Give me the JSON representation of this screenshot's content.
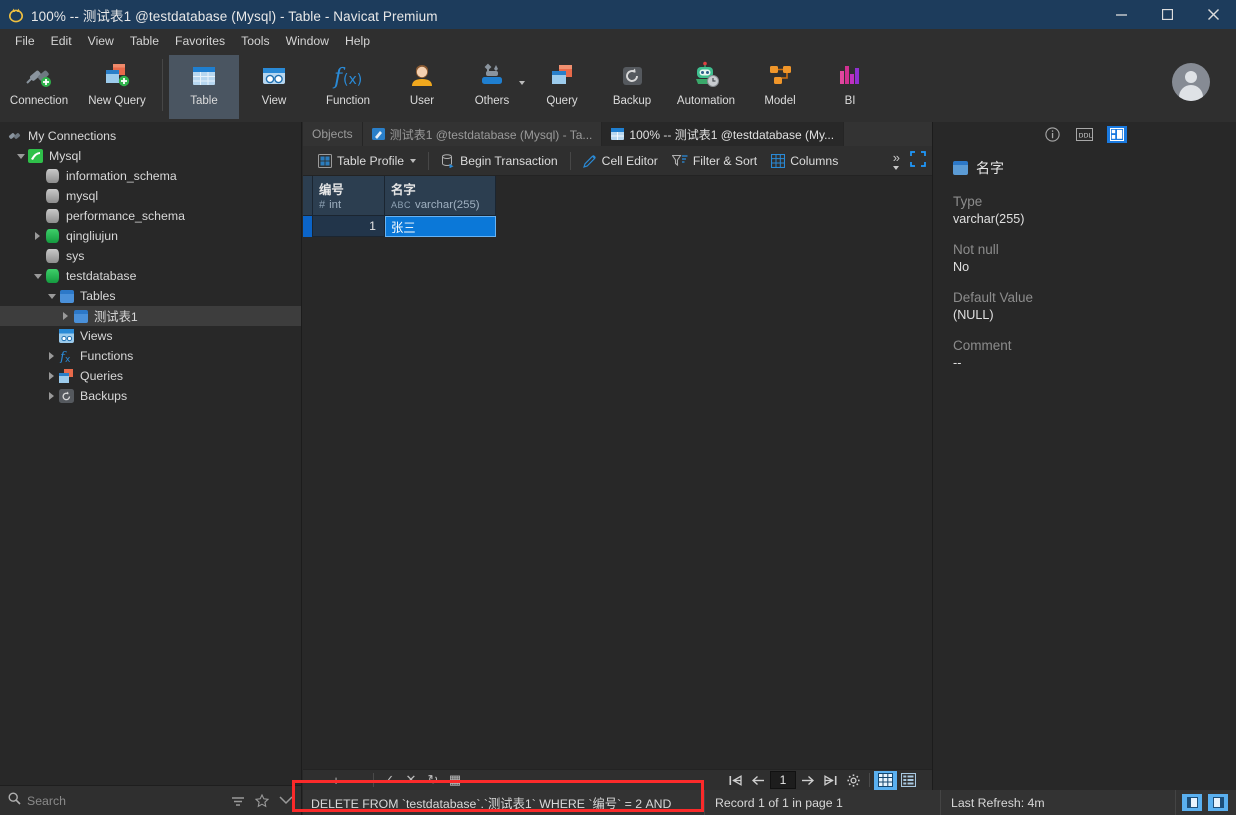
{
  "window": {
    "title": "100% -- 测试表1 @testdatabase (Mysql) - Table - Navicat Premium",
    "minimize": "—",
    "maximize": "▢",
    "close": "✕"
  },
  "menubar": {
    "items": [
      "File",
      "Edit",
      "View",
      "Table",
      "Favorites",
      "Tools",
      "Window",
      "Help"
    ]
  },
  "toolbar": {
    "items": [
      {
        "label": "Connection",
        "icon": "connection-icon",
        "active": false
      },
      {
        "label": "New Query",
        "icon": "new-query-icon",
        "active": false
      },
      {
        "label": "Table",
        "icon": "table-icon",
        "active": true
      },
      {
        "label": "View",
        "icon": "view-icon",
        "active": false
      },
      {
        "label": "Function",
        "icon": "function-icon",
        "active": false
      },
      {
        "label": "User",
        "icon": "user-icon",
        "active": false
      },
      {
        "label": "Others",
        "icon": "others-icon",
        "active": false
      },
      {
        "label": "Query",
        "icon": "query-icon",
        "active": false
      },
      {
        "label": "Backup",
        "icon": "backup-icon",
        "active": false
      },
      {
        "label": "Automation",
        "icon": "automation-icon",
        "active": false
      },
      {
        "label": "Model",
        "icon": "model-icon",
        "active": false
      },
      {
        "label": "BI",
        "icon": "bi-icon",
        "active": false
      }
    ]
  },
  "sidebar": {
    "tree": [
      {
        "label": "My Connections",
        "depth": 0,
        "icon": "connection-icon",
        "arrow": "none",
        "selected": false
      },
      {
        "label": "Mysql",
        "depth": 1,
        "icon": "mysql-icon",
        "arrow": "open",
        "selected": false
      },
      {
        "label": "information_schema",
        "depth": 2,
        "icon": "db-gray-icon",
        "arrow": "none",
        "selected": false
      },
      {
        "label": "mysql",
        "depth": 2,
        "icon": "db-gray-icon",
        "arrow": "none",
        "selected": false
      },
      {
        "label": "performance_schema",
        "depth": 2,
        "icon": "db-gray-icon",
        "arrow": "none",
        "selected": false
      },
      {
        "label": "qingliujun",
        "depth": 2,
        "icon": "db-green-icon",
        "arrow": "closed",
        "selected": false
      },
      {
        "label": "sys",
        "depth": 2,
        "icon": "db-gray-icon",
        "arrow": "none",
        "selected": false
      },
      {
        "label": "testdatabase",
        "depth": 2,
        "icon": "db-green-icon",
        "arrow": "open",
        "selected": false
      },
      {
        "label": "Tables",
        "depth": 3,
        "icon": "tables-icon",
        "arrow": "open",
        "selected": false
      },
      {
        "label": "测试表1",
        "depth": 4,
        "icon": "table-blue-icon",
        "arrow": "closed",
        "selected": true
      },
      {
        "label": "Views",
        "depth": 3,
        "icon": "views-icon",
        "arrow": "none",
        "selected": false
      },
      {
        "label": "Functions",
        "depth": 3,
        "icon": "functions-icon",
        "arrow": "closed",
        "selected": false
      },
      {
        "label": "Queries",
        "depth": 3,
        "icon": "queries-icon",
        "arrow": "closed",
        "selected": false
      },
      {
        "label": "Backups",
        "depth": 3,
        "icon": "backups-icon",
        "arrow": "closed",
        "selected": false
      }
    ],
    "search_placeholder": "Search"
  },
  "tabs": [
    {
      "label": "Objects",
      "active": false,
      "icon": "none"
    },
    {
      "label": "测试表1 @testdatabase (Mysql) - Ta...",
      "active": false,
      "icon": "table-design-icon"
    },
    {
      "label": "100% -- 测试表1 @testdatabase (My...",
      "active": true,
      "icon": "table-data-icon"
    }
  ],
  "subtoolbar": {
    "table_profile": "Table Profile",
    "begin_transaction": "Begin Transaction",
    "cell_editor": "Cell Editor",
    "filter_sort": "Filter & Sort",
    "columns": "Columns",
    "overflow": "»"
  },
  "grid": {
    "columns": [
      {
        "name": "编号",
        "type": "int",
        "type_mark": "#",
        "width": 82
      },
      {
        "name": "名字",
        "type": "varchar(255)",
        "type_mark": "ABC",
        "width": 111
      }
    ],
    "rows": [
      {
        "编号": "1",
        "名字": "张三",
        "selected_cell": "名字"
      }
    ]
  },
  "grid_tools": {
    "add": "+",
    "remove": "−",
    "apply": "✓",
    "cancel": "✕",
    "refresh": "↻",
    "grid": "▦"
  },
  "sql_preview": {
    "text": "DELETE FROM `testdatabase`.`测试表1` WHERE `编号` = 2 AND",
    "warning_icon": "warning-triangle-icon"
  },
  "pager": {
    "first": "|←",
    "prev": "←",
    "page": "1",
    "next": "→",
    "last": "→|",
    "settings": "gear-icon",
    "grid_view": "grid-view-icon",
    "form_view": "form-view-icon"
  },
  "status": {
    "record": "Record 1 of 1 in page 1",
    "refresh": "Last Refresh: 4m",
    "left_panel_toggle": "left-panel-toggle-icon",
    "right_panel_toggle": "right-panel-toggle-icon"
  },
  "right_panel": {
    "tabs": [
      {
        "icon": "info-icon",
        "active": false
      },
      {
        "icon": "ddl-icon",
        "active": false
      },
      {
        "icon": "structure-icon",
        "active": true
      }
    ],
    "title": "名字",
    "fields": [
      {
        "label": "Type",
        "value": "varchar(255)"
      },
      {
        "label": "Not null",
        "value": "No"
      },
      {
        "label": "Default Value",
        "value": "(NULL)"
      },
      {
        "label": "Comment",
        "value": "--"
      }
    ]
  },
  "annotation": {
    "highlight_color": "#fa2a2a"
  }
}
